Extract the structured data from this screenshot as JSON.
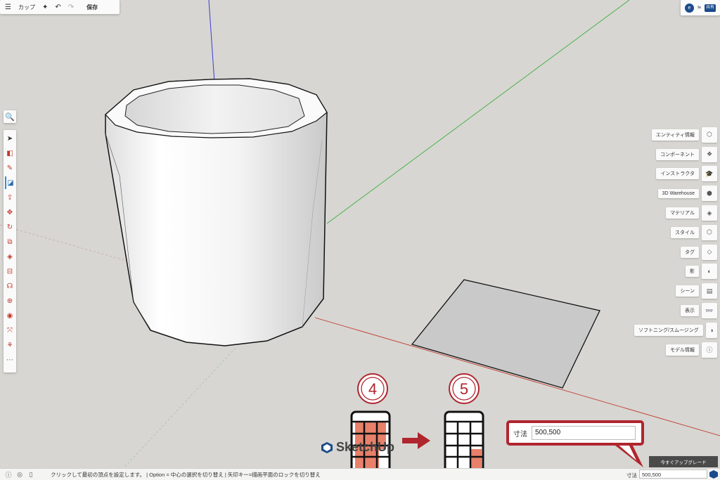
{
  "topbar": {
    "menu_icon": "menu-icon",
    "title": "カップ",
    "save_label": "保存"
  },
  "topright": {
    "avatar_initial": "e",
    "share_label": "共有"
  },
  "right_panel": {
    "items": [
      {
        "label": "エンティティ情報",
        "icon": "entity-info-icon",
        "glyph": "⬡"
      },
      {
        "label": "コンポーネント",
        "icon": "components-icon",
        "glyph": "❖"
      },
      {
        "label": "インストラクタ",
        "icon": "instructor-icon",
        "glyph": "🎓"
      },
      {
        "label": "3D Warehouse",
        "icon": "warehouse-icon",
        "glyph": "⬢"
      },
      {
        "label": "マテリアル",
        "icon": "materials-icon",
        "glyph": "◈"
      },
      {
        "label": "スタイル",
        "icon": "styles-icon",
        "glyph": "⬡"
      },
      {
        "label": "タグ",
        "icon": "tags-icon",
        "glyph": "◇"
      },
      {
        "label": "影",
        "icon": "shadows-icon",
        "glyph": "◐"
      },
      {
        "label": "シーン",
        "icon": "scenes-icon",
        "glyph": "▤"
      },
      {
        "label": "表示",
        "icon": "display-icon",
        "glyph": "👓"
      },
      {
        "label": "ソフトニング/スムージング",
        "icon": "soften-icon",
        "glyph": "◑"
      },
      {
        "label": "モデル情報",
        "icon": "model-info-icon",
        "glyph": "ⓘ"
      }
    ]
  },
  "statusbar": {
    "message": "クリックして最初の頂点を設定します。 | Option = 中心の選択を切り替え | 矢印キー=描画平面のロックを切り替え",
    "dimension_label": "寸法",
    "dimension_value": "500,500"
  },
  "upgrade_label": "今すぐアップグレード",
  "callout": {
    "label": "寸法",
    "value": "500,500"
  },
  "steps": {
    "step4": "4",
    "step5": "5"
  },
  "logo_text": "SketchUp",
  "colors": {
    "accent_red": "#b0262f",
    "keypad_fill": "#e8806a",
    "axis_blue": "#3b3bd6",
    "axis_green": "#3fae3f",
    "axis_red": "#c0392b",
    "brand_blue": "#1b4b8c"
  }
}
